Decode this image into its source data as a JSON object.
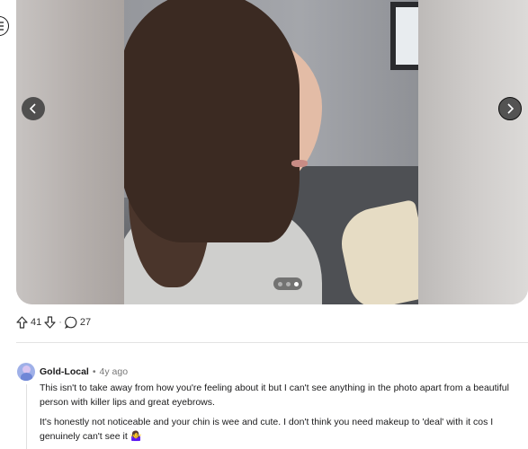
{
  "post": {
    "upvote_count": "41",
    "comment_count": "27",
    "carousel_total": 3,
    "carousel_active": 3
  },
  "comment": {
    "author": "Gold-Local",
    "separator": "•",
    "age": "4y ago",
    "paragraphs": [
      "This isn't to take away from how you're feeling about it but I can't see anything in the photo apart from a beautiful person with killer lips and great eyebrows.",
      "It's honestly not noticeable and your chin is wee and cute. I don't think you need makeup to 'deal' with it cos I genuinely can't see it 🤷‍♀️"
    ]
  },
  "actions_separator": "·",
  "colors": {
    "accent_avatar": "#9fb0e8",
    "nav_button": "#3c3c3c",
    "text_primary": "#1a1a1b",
    "text_muted": "#777777"
  },
  "icons": {
    "menu": "menu-icon",
    "prev": "chevron-left-icon",
    "next": "chevron-right-icon",
    "upvote": "upvote-icon",
    "downvote": "downvote-icon",
    "comments": "comment-bubble-icon"
  }
}
